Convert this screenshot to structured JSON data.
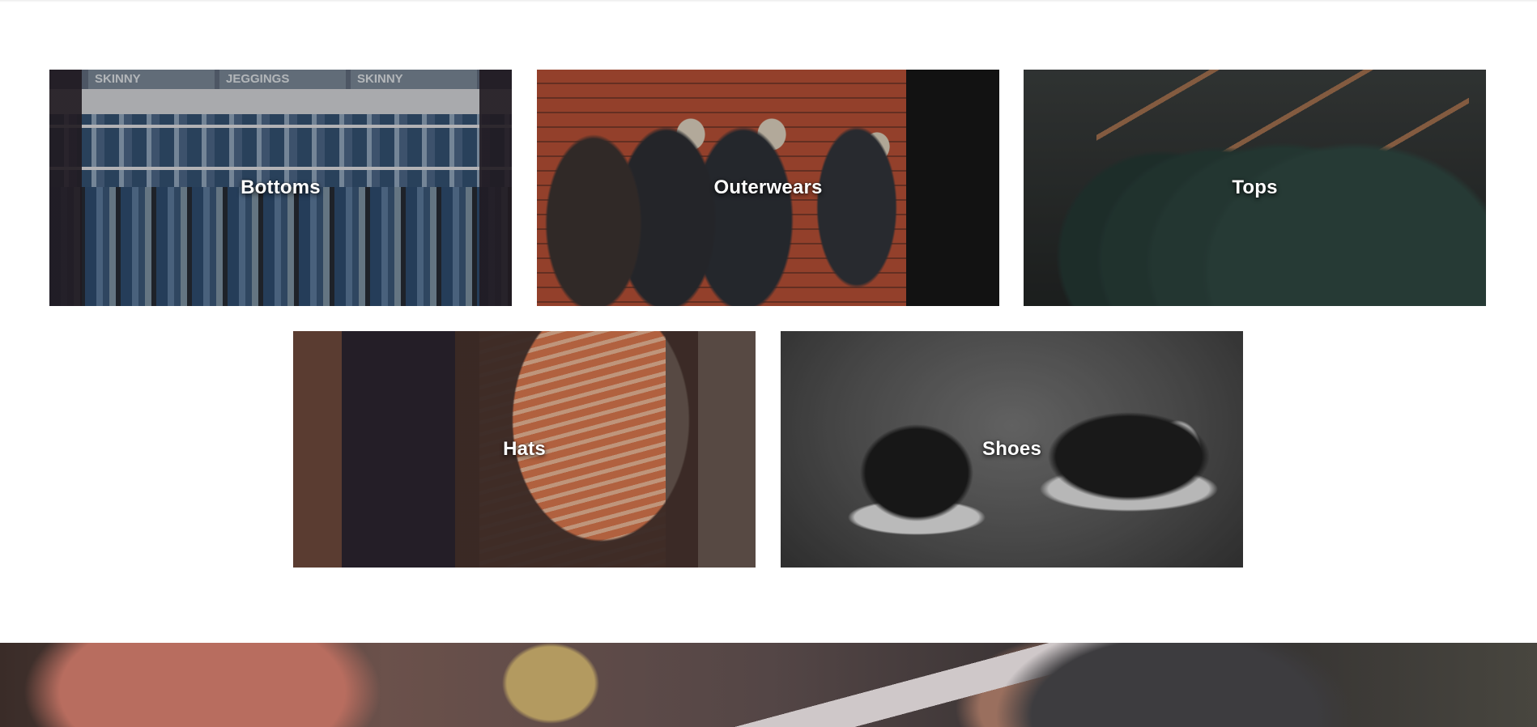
{
  "categories": {
    "items": [
      {
        "label": "Bottoms"
      },
      {
        "label": "Outerwears"
      },
      {
        "label": "Tops"
      },
      {
        "label": "Hats"
      },
      {
        "label": "Shoes"
      }
    ],
    "bottoms_signs": [
      "SKINNY",
      "JEGGINGS",
      "SKINNY"
    ]
  },
  "colors": {
    "tile_text": "#ffffff",
    "page_background": "#ffffff"
  }
}
